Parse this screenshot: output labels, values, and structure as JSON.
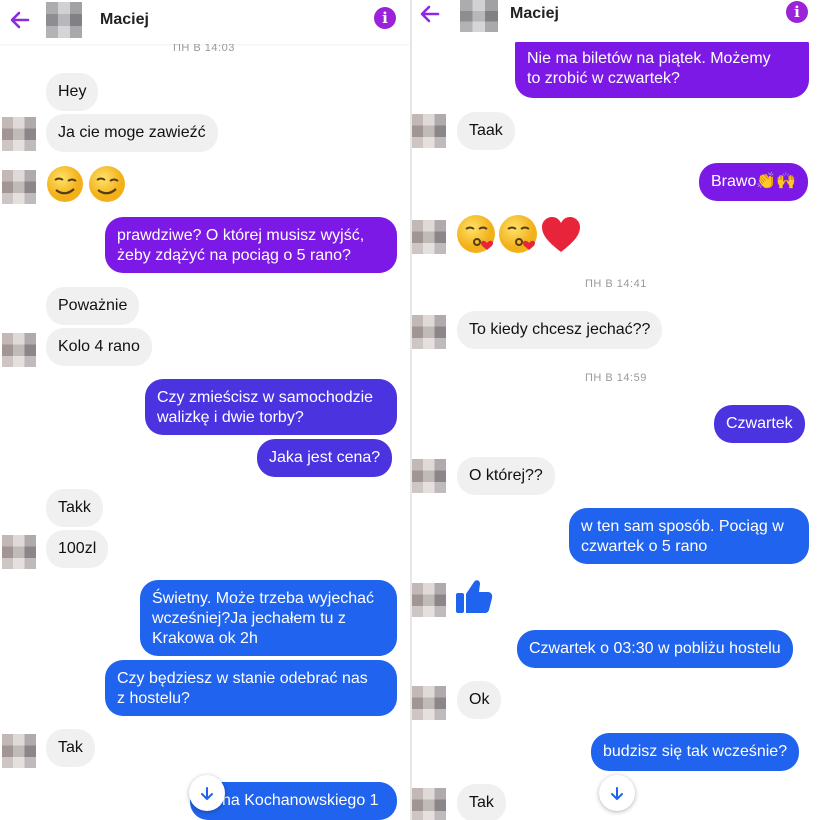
{
  "left": {
    "header": {
      "name": "Maciej"
    },
    "timestamp": "ПН В 14:03",
    "messages": {
      "m1": "Hey",
      "m2": "Ja cie moge zawieźć",
      "m3a": "prawdziwe? O której musisz wyjść,",
      "m3b": "żeby zdążyć na pociąg o 5 rano?",
      "m4": "Poważnie",
      "m5": "Kolo 4 rano",
      "m6a": "Czy zmieścisz w samochodzie",
      "m6b": "walizkę i dwie torby?",
      "m7": "Jaka jest cena?",
      "m8": "Takk",
      "m9": "100zl",
      "m10a": "Świetny. Może trzeba wyjechać",
      "m10b": "wcześniej?Ja jechałem tu z",
      "m10c": "Krakowa ok 2h",
      "m11a": "Czy będziesz w stanie odebrać nas",
      "m11b": "z hostelu?",
      "m12": "Tak",
      "m13": "na Kochanowskiego 1"
    }
  },
  "right": {
    "header": {
      "name": "Maciej"
    },
    "timestamps": {
      "t1": "ПН В 14:41",
      "t2": "ПН В 14:59"
    },
    "messages": {
      "r1a": "Nie ma biletów na piątek. Możemy",
      "r1b": "to zrobić w czwartek?",
      "r2": "Taak",
      "r3": "Brawo👏🙌",
      "r4": "To kiedy chcesz jechać??",
      "r5": "Czwartek",
      "r6": "O której??",
      "r7a": "w ten sam sposób. Pociąg w",
      "r7b": "czwartek o 5 rano",
      "r8": "Czwartek o 03:30 w pobliżu hostelu",
      "r9": "Ok",
      "r10": "budzisz się tak wcześnie?",
      "r11": "Tak"
    }
  },
  "colors": {
    "accent": "#9b22d8",
    "outgoing_purple": "#7d19e6",
    "outgoing_violet": "#4b34e0",
    "outgoing_blue": "#1f63ee",
    "incoming": "#f0f0f0"
  },
  "icons": {
    "back": "arrow-left-icon",
    "info": "info-icon",
    "scroll": "arrow-down-icon",
    "like": "thumbs-up-icon"
  }
}
